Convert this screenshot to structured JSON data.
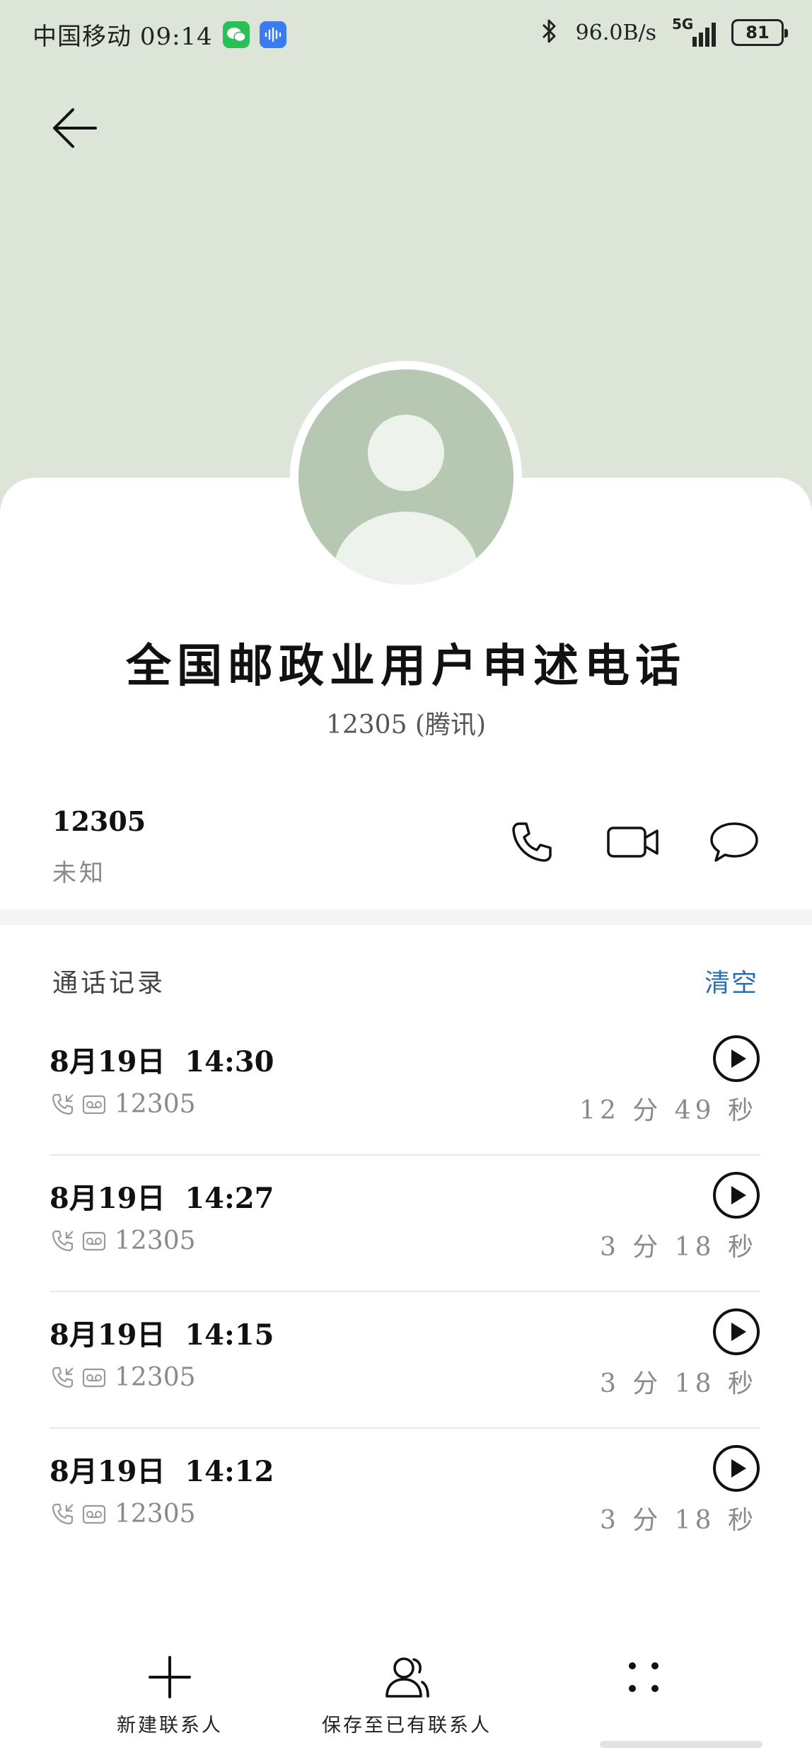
{
  "status_bar": {
    "carrier": "中国移动",
    "time": "09:14",
    "net_speed": "96.0B/s",
    "network": "5G",
    "battery": "81"
  },
  "contact": {
    "name": "全国邮政业用户申述电话",
    "subtitle": "12305 (腾讯)",
    "number": "12305",
    "number_label": "未知"
  },
  "call_log": {
    "title": "通话记录",
    "clear_label": "清空",
    "items": [
      {
        "datetime": "8月19日  14:30",
        "number": "12305",
        "duration": "12 分 49 秒"
      },
      {
        "datetime": "8月19日  14:27",
        "number": "12305",
        "duration": "3 分 18 秒"
      },
      {
        "datetime": "8月19日  14:15",
        "number": "12305",
        "duration": "3 分 18 秒"
      },
      {
        "datetime": "8月19日  14:12",
        "number": "12305",
        "duration": "3 分 18 秒"
      }
    ]
  },
  "bottom_bar": {
    "new_contact": "新建联系人",
    "save_existing": "保存至已有联系人"
  },
  "colors": {
    "header_bg": "#dce5d7",
    "avatar_bg": "#b6c8b2",
    "accent_link": "#2a6fb6",
    "wechat": "#2bbf58",
    "voice_app": "#3a7bf0"
  },
  "icons": {
    "back": "arrow-left-icon",
    "call": "phone-icon",
    "video": "video-camera-icon",
    "message": "chat-bubble-icon",
    "play": "play-circle-icon",
    "incoming": "incoming-call-icon",
    "recording": "voicemail-icon",
    "new_contact": "plus-icon",
    "save_existing": "add-person-icon",
    "more": "more-dots-icon"
  }
}
